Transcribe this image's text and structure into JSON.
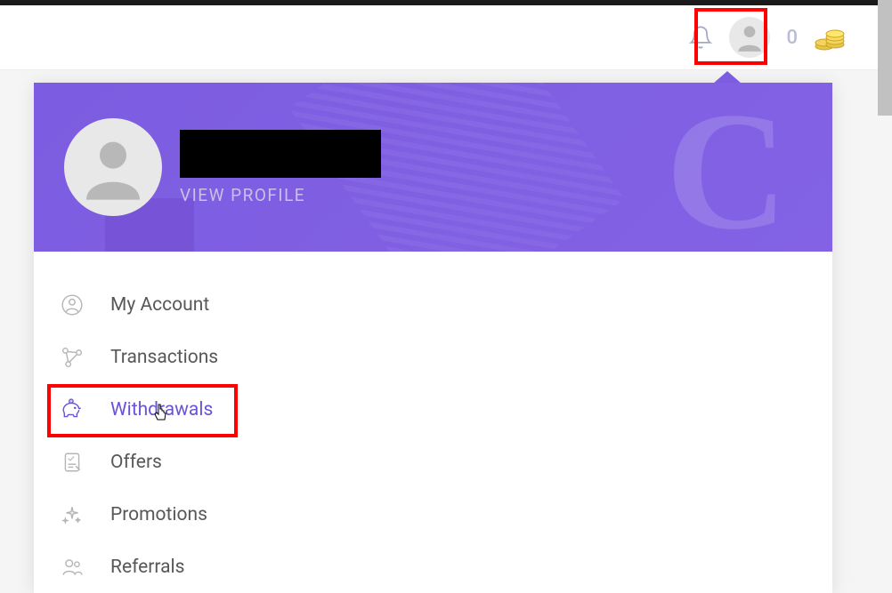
{
  "header": {
    "coin_count": "0"
  },
  "profile": {
    "view_profile_label": "VIEW PROFILE"
  },
  "menu": {
    "items": [
      {
        "label": "My Account"
      },
      {
        "label": "Transactions"
      },
      {
        "label": "Withdrawals"
      },
      {
        "label": "Offers"
      },
      {
        "label": "Promotions"
      },
      {
        "label": "Referrals"
      }
    ]
  }
}
